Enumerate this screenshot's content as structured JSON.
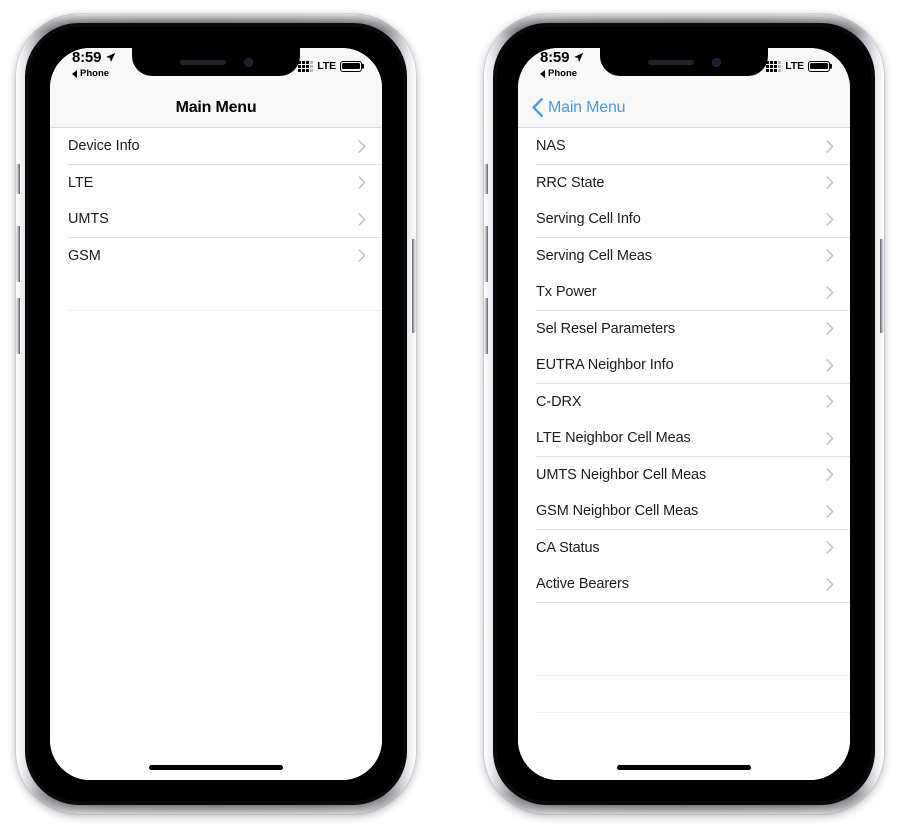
{
  "status_bar": {
    "time": "8:59",
    "location_icon": "location-arrow-icon",
    "back_to_app_label": "Phone",
    "back_triangle_icon": "back-triangle-icon",
    "signal_icon": "cellular-signal-dots-icon",
    "network_type": "LTE",
    "battery_icon": "battery-full-icon"
  },
  "phone_left": {
    "nav": {
      "title": "Main Menu"
    },
    "menu_items": [
      {
        "label": "Device Info",
        "chevron": "chevron-right-icon"
      },
      {
        "label": "LTE",
        "chevron": "chevron-right-icon"
      },
      {
        "label": "UMTS",
        "chevron": "chevron-right-icon"
      },
      {
        "label": "GSM",
        "chevron": "chevron-right-icon"
      }
    ]
  },
  "phone_right": {
    "nav": {
      "back_label": "Main Menu",
      "back_chevron": "chevron-left-icon"
    },
    "menu_items": [
      {
        "label": "NAS",
        "chevron": "chevron-right-icon"
      },
      {
        "label": "RRC State",
        "chevron": "chevron-right-icon"
      },
      {
        "label": "Serving Cell Info",
        "chevron": "chevron-right-icon"
      },
      {
        "label": "Serving Cell Meas",
        "chevron": "chevron-right-icon"
      },
      {
        "label": "Tx Power",
        "chevron": "chevron-right-icon"
      },
      {
        "label": "Sel Resel Parameters",
        "chevron": "chevron-right-icon"
      },
      {
        "label": "EUTRA Neighbor Info",
        "chevron": "chevron-right-icon"
      },
      {
        "label": "C-DRX",
        "chevron": "chevron-right-icon"
      },
      {
        "label": "LTE Neighbor Cell Meas",
        "chevron": "chevron-right-icon"
      },
      {
        "label": "UMTS Neighbor Cell Meas",
        "chevron": "chevron-right-icon"
      },
      {
        "label": "GSM Neighbor Cell Meas",
        "chevron": "chevron-right-icon"
      },
      {
        "label": "CA Status",
        "chevron": "chevron-right-icon"
      },
      {
        "label": "Active Bearers",
        "chevron": "chevron-right-icon"
      }
    ]
  },
  "colors": {
    "tint_blue": "#4a9ae0",
    "list_text": "#1c1c1e",
    "separator": "#e2e2e5",
    "bar_background": "#f8f8f8"
  }
}
